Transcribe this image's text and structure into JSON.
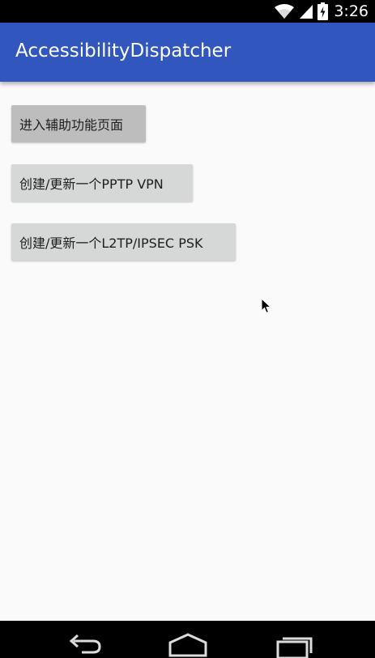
{
  "status_bar": {
    "time": "3:26",
    "icons": [
      "wifi-icon",
      "signal-icon",
      "battery-charging-icon"
    ]
  },
  "action_bar": {
    "title": "AccessibilityDispatcher",
    "color": "#3157bf"
  },
  "buttons": [
    {
      "label": "进入辅助功能页面"
    },
    {
      "label": "创建/更新一个PPTP VPN"
    },
    {
      "label": "创建/更新一个L2TP/IPSEC PSK"
    }
  ],
  "nav_bar": {
    "icons": [
      "back-icon",
      "home-icon",
      "recents-icon"
    ]
  }
}
